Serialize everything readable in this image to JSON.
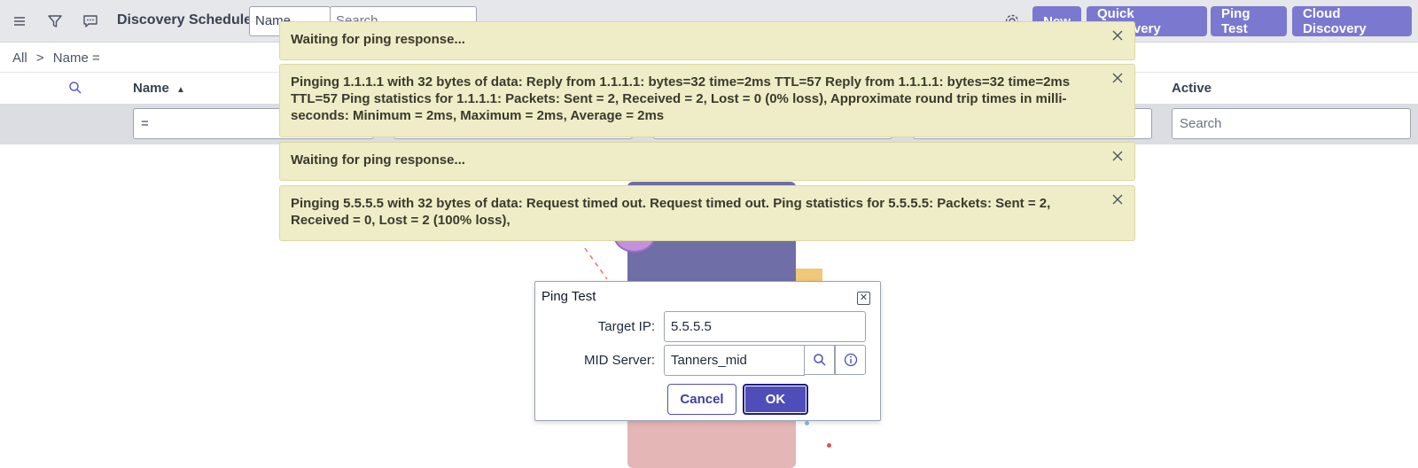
{
  "header": {
    "title": "Discovery Schedules",
    "filter_field": "Name",
    "search_placeholder": "Search",
    "buttons": {
      "new": "New",
      "quick_discovery": "Quick Discovery",
      "ping_test": "Ping Test",
      "cloud_discovery": "Cloud Discovery"
    },
    "accent_color": "#7b78cf"
  },
  "breadcrumb": {
    "all": "All",
    "separator": ">",
    "filter": "Name ="
  },
  "table": {
    "columns": {
      "name": "Name",
      "active": "Active"
    },
    "sort_indicator": "▲",
    "filters": {
      "name": "=",
      "active_placeholder": "Search"
    }
  },
  "notifications": [
    {
      "text": "Waiting for ping response..."
    },
    {
      "text": "Pinging 1.1.1.1 with 32 bytes of data: Reply from 1.1.1.1: bytes=32 time=2ms TTL=57 Reply from 1.1.1.1: bytes=32 time=2ms TTL=57 Ping statistics for 1.1.1.1: Packets: Sent = 2, Received = 2, Lost = 0 (0% loss), Approximate round trip times in milli-seconds: Minimum = 2ms, Maximum = 2ms, Average = 2ms"
    },
    {
      "text": "Waiting for ping response..."
    },
    {
      "text": "Pinging 5.5.5.5 with 32 bytes of data: Request timed out. Request timed out. Ping statistics for 5.5.5.5: Packets: Sent = 2, Received = 0, Lost = 2 (100% loss),"
    }
  ],
  "dialog": {
    "title": "Ping Test",
    "target_ip_label": "Target IP:",
    "target_ip_value": "5.5.5.5",
    "mid_server_label": "MID Server:",
    "mid_server_value": "Tanners_mid",
    "cancel_label": "Cancel",
    "ok_label": "OK",
    "button_color": "#4f4db8"
  },
  "icons": [
    "menu-icon",
    "filter-icon",
    "comment-icon",
    "gear-icon",
    "search-icon",
    "info-icon",
    "close-icon",
    "sort-up-icon"
  ]
}
